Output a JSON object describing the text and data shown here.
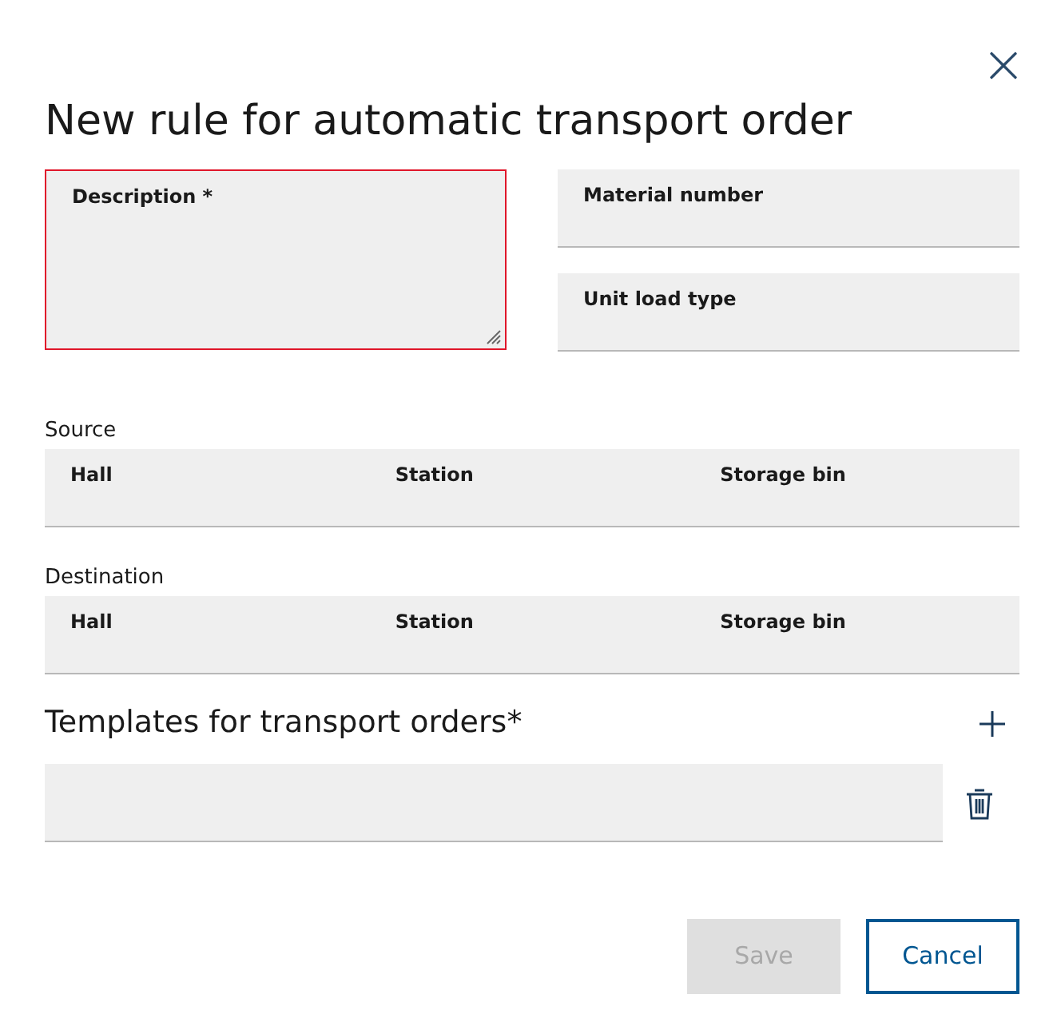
{
  "dialog": {
    "title": "New rule for automatic transport order"
  },
  "description": {
    "label": "Description *",
    "invalid": true
  },
  "right_fields": [
    {
      "label": "Material number"
    },
    {
      "label": "Unit load type"
    }
  ],
  "groups": [
    {
      "title": "Source",
      "fields": [
        {
          "label": "Hall"
        },
        {
          "label": "Station"
        },
        {
          "label": "Storage bin"
        }
      ]
    },
    {
      "title": "Destination",
      "fields": [
        {
          "label": "Hall"
        },
        {
          "label": "Station"
        },
        {
          "label": "Storage bin"
        }
      ]
    }
  ],
  "templates": {
    "title": "Templates for transport orders*",
    "rows": [
      {
        "kind": "empty"
      }
    ]
  },
  "buttons": [
    {
      "label": "Save",
      "kind": "primary",
      "disabled": true
    },
    {
      "label": "Cancel",
      "kind": "secondary"
    }
  ]
}
